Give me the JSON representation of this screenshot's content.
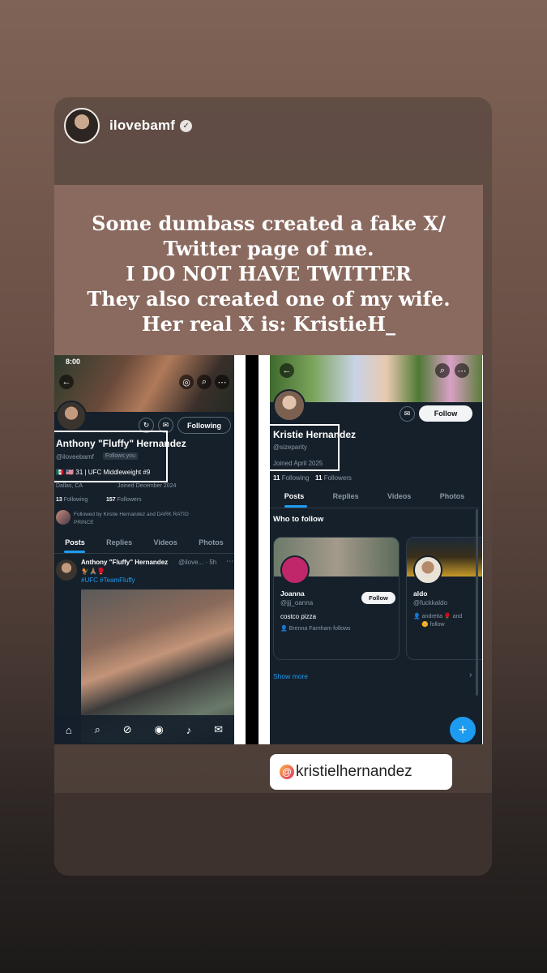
{
  "story": {
    "username": "ilovebamf",
    "caption_lines": [
      "Some dumbass created a fake X/",
      "Twitter page of me.",
      "I DO NOT HAVE TWITTER",
      "They also created one of my wife.",
      "Her real X is: KristieH_"
    ],
    "mention_tag": "kristielhernandez"
  },
  "left_profile": {
    "status_time": "8:00",
    "display_name": "Anthony \"Fluffy\" Hernandez",
    "handle": "@iloveebamf",
    "follows_you": "Follows you",
    "bio": "🇲🇽 🇺🇸 31 | UFC Middleweight #9",
    "location": "Dallas, CA",
    "joined": "Joined December 2024",
    "following_count": "13",
    "following_label": "Following",
    "followers_count": "157",
    "followers_label": "Followers",
    "followed_by": "Followed by Kristie Hernandez and DARK RATIO",
    "followed_by_2": "PRINCE",
    "following_button": "Following",
    "tabs": [
      "Posts",
      "Replies",
      "Videos",
      "Photos"
    ],
    "post_author": "Anthony \"Fluffy\" Hernandez",
    "post_meta": "@ilove... · 5h",
    "post_emojis": "🐓🙏🏽🥊",
    "post_hashtags": "#UFC #TeamFluffy"
  },
  "right_profile": {
    "display_name": "Kristie Hernandez",
    "handle": "@sizeparity",
    "joined": "Joined April 2025",
    "following_count": "11",
    "following_label": "Following",
    "followers_count": "11",
    "followers_label": "Followers",
    "follow_button": "Follow",
    "tabs": [
      "Posts",
      "Replies",
      "Videos",
      "Photos"
    ],
    "who_to_follow": "Who to follow",
    "suggestions": [
      {
        "name": "Joanna",
        "handle": "@jjj_oanna",
        "bio": "costco pizza",
        "follows": "Brenna Farnham follows",
        "button": "Follow"
      },
      {
        "name": "aldo",
        "handle": "@fuckkaldo",
        "bio": "andreita 🌹 and",
        "follows": "🌼 follow"
      }
    ],
    "show_more": "Show more"
  },
  "colors": {
    "x_dark": "#15202b",
    "x_blue": "#1d9bf0",
    "story_bg": "#6a5046"
  }
}
